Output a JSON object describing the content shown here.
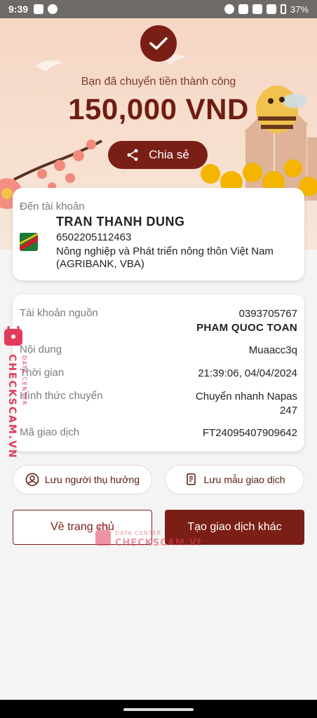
{
  "status_bar": {
    "time": "9:39",
    "battery": "37%"
  },
  "hero": {
    "title": "Bạn đã chuyển tiền thành công",
    "amount": "150,000 VND",
    "share_label": "Chia sẻ"
  },
  "destination": {
    "label": "Đến tài khoản",
    "name": "TRAN THANH DUNG",
    "account": "6502205112463",
    "bank": "Nông nghiệp và Phát triển nông thôn Việt Nam (AGRIBANK, VBA)"
  },
  "details": {
    "source_label": "Tài khoản nguồn",
    "source_account": "0393705767",
    "source_name": "PHAM QUOC TOAN",
    "content_label": "Nội dung",
    "content_value": "Muaacc3q",
    "time_label": "Thời gian",
    "time_value": "21:39:06, 04/04/2024",
    "method_label": "Hình thức chuyển",
    "method_value_line1": "Chuyển nhanh Napas",
    "method_value_line2": "247",
    "txn_label": "Mã giao dịch",
    "txn_value": "FT24095407909642"
  },
  "actions": {
    "save_recipient": "Lưu người thụ hưởng",
    "save_template": "Lưu mẫu giao dịch",
    "home": "Về trang chủ",
    "new_transaction": "Tạo giao dịch khác"
  },
  "watermark": {
    "top": "DATA CENTER",
    "brand": "CHECKSCAM.VN"
  },
  "colors": {
    "primary": "#7a1f16",
    "hero_bg": "#f6d6c4"
  }
}
